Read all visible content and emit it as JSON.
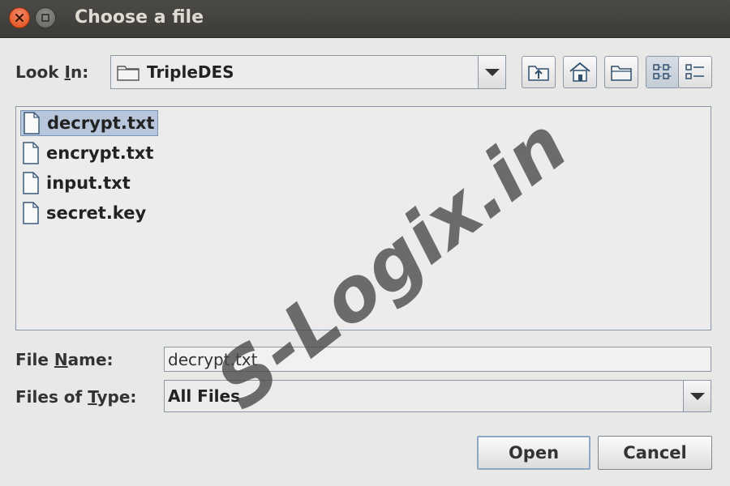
{
  "window": {
    "title": "Choose a file"
  },
  "look_in": {
    "label_pre": "Look ",
    "label_mnemonic": "I",
    "label_post": "n:",
    "value": "TripleDES"
  },
  "toolbar": {
    "icons": [
      "up-folder-icon",
      "home-icon",
      "new-folder-icon",
      "list-view-icon",
      "details-view-icon"
    ],
    "active": "list-view-icon"
  },
  "files": [
    {
      "name": "decrypt.txt",
      "selected": true
    },
    {
      "name": "encrypt.txt",
      "selected": false
    },
    {
      "name": "input.txt",
      "selected": false
    },
    {
      "name": "secret.key",
      "selected": false
    }
  ],
  "file_name": {
    "label_pre": "File ",
    "label_mnemonic": "N",
    "label_post": "ame:",
    "value": "decrypt.txt"
  },
  "file_type": {
    "label_pre": "Files of ",
    "label_mnemonic": "T",
    "label_post": "ype:",
    "value": "All Files"
  },
  "buttons": {
    "open": "Open",
    "cancel": "Cancel"
  },
  "watermark": "S-Logix.in"
}
